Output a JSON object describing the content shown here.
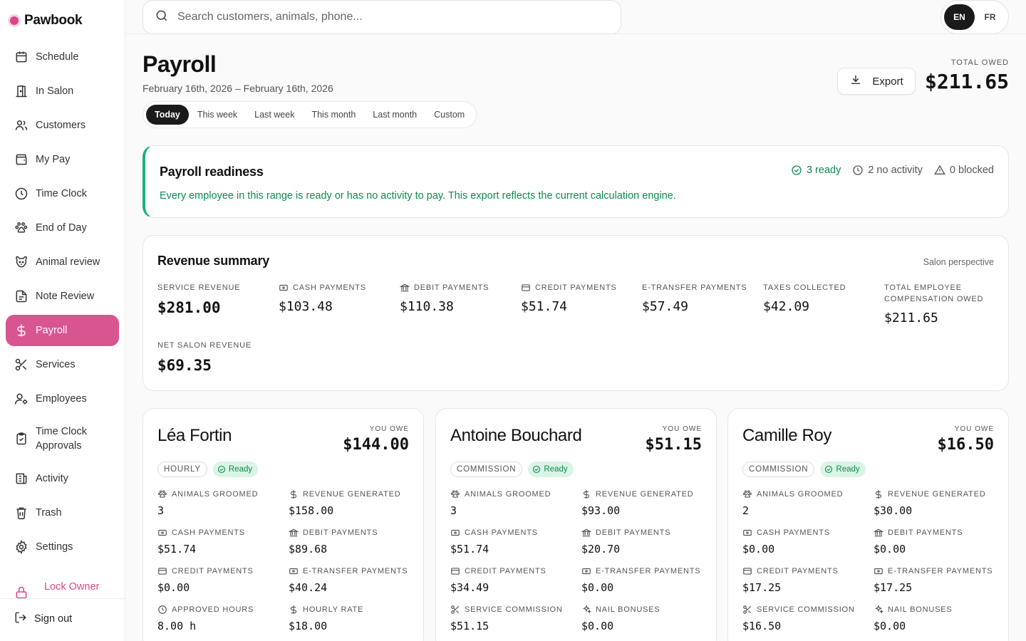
{
  "brand": {
    "name": "Pawbook",
    "accent": "#d9468c"
  },
  "sidebar": {
    "items": [
      {
        "label": "Schedule",
        "icon": "calendar-icon"
      },
      {
        "label": "In Salon",
        "icon": "door-icon"
      },
      {
        "label": "Customers",
        "icon": "users-icon"
      },
      {
        "label": "My Pay",
        "icon": "wallet-icon"
      },
      {
        "label": "Time Clock",
        "icon": "clock-icon"
      },
      {
        "label": "End of Day",
        "icon": "paw-icon"
      },
      {
        "label": "Animal review",
        "icon": "dog-icon"
      },
      {
        "label": "Note Review",
        "icon": "note-icon"
      },
      {
        "label": "Payroll",
        "icon": "dollar-icon",
        "active": true
      },
      {
        "label": "Services",
        "icon": "scissors-icon"
      },
      {
        "label": "Employees",
        "icon": "user-cog-icon"
      },
      {
        "label": "Time Clock Approvals",
        "icon": "clipboard-check-icon"
      },
      {
        "label": "Activity",
        "icon": "activity-icon"
      },
      {
        "label": "Trash",
        "icon": "trash-icon"
      },
      {
        "label": "Settings",
        "icon": "gear-icon"
      }
    ],
    "lock_label": "Lock Owner",
    "signout_label": "Sign out"
  },
  "topbar": {
    "search_placeholder": "Search customers, animals, phone...",
    "lang_en": "EN",
    "lang_fr": "FR"
  },
  "header": {
    "title": "Payroll",
    "date_range": "February 16th, 2026 – February 16th, 2026",
    "tabs": [
      "Today",
      "This week",
      "Last week",
      "This month",
      "Last month",
      "Custom"
    ],
    "active_tab": "Today",
    "export_label": "Export",
    "total_owed_label": "TOTAL OWED",
    "total_owed_value": "$211.65"
  },
  "readiness": {
    "title": "Payroll readiness",
    "message": "Every employee in this range is ready or has no activity to pay. This export reflects the current calculation engine.",
    "ready": "3 ready",
    "no_activity": "2 no activity",
    "blocked": "0 blocked",
    "status_color": "#19b37a"
  },
  "revenue": {
    "title": "Revenue summary",
    "perspective": "Salon perspective",
    "service_revenue": {
      "label": "SERVICE REVENUE",
      "value": "$281.00"
    },
    "cash": {
      "label": "CASH PAYMENTS",
      "value": "$103.48"
    },
    "debit": {
      "label": "DEBIT PAYMENTS",
      "value": "$110.38"
    },
    "credit": {
      "label": "CREDIT PAYMENTS",
      "value": "$51.74"
    },
    "etransfer": {
      "label": "E-TRANSFER PAYMENTS",
      "value": "$57.49"
    },
    "taxes": {
      "label": "TAXES COLLECTED",
      "value": "$42.09"
    },
    "total_comp": {
      "label": "TOTAL EMPLOYEE COMPENSATION OWED",
      "value": "$211.65"
    },
    "net": {
      "label": "NET SALON REVENUE",
      "value": "$69.35"
    }
  },
  "employees": [
    {
      "name": "Léa Fortin",
      "owe_label": "YOU OWE",
      "owe": "$144.00",
      "type": "HOURLY",
      "status": "Ready",
      "metrics": [
        {
          "label": "ANIMALS GROOMED",
          "value": "3"
        },
        {
          "label": "REVENUE GENERATED",
          "value": "$158.00"
        },
        {
          "label": "CASH PAYMENTS",
          "value": "$51.74"
        },
        {
          "label": "DEBIT PAYMENTS",
          "value": "$89.68"
        },
        {
          "label": "CREDIT PAYMENTS",
          "value": "$0.00"
        },
        {
          "label": "E-TRANSFER PAYMENTS",
          "value": "$40.24"
        },
        {
          "label": "APPROVED HOURS",
          "value": "8.00 h"
        },
        {
          "label": "HOURLY RATE",
          "value": "$18.00"
        }
      ]
    },
    {
      "name": "Antoine Bouchard",
      "owe_label": "YOU OWE",
      "owe": "$51.15",
      "type": "COMMISSION",
      "status": "Ready",
      "metrics": [
        {
          "label": "ANIMALS GROOMED",
          "value": "3"
        },
        {
          "label": "REVENUE GENERATED",
          "value": "$93.00"
        },
        {
          "label": "CASH PAYMENTS",
          "value": "$51.74"
        },
        {
          "label": "DEBIT PAYMENTS",
          "value": "$20.70"
        },
        {
          "label": "CREDIT PAYMENTS",
          "value": "$34.49"
        },
        {
          "label": "E-TRANSFER PAYMENTS",
          "value": "$0.00"
        },
        {
          "label": "SERVICE COMMISSION",
          "value": "$51.15"
        },
        {
          "label": "NAIL BONUSES",
          "value": "$0.00"
        }
      ]
    },
    {
      "name": "Camille Roy",
      "owe_label": "YOU OWE",
      "owe": "$16.50",
      "type": "COMMISSION",
      "status": "Ready",
      "metrics": [
        {
          "label": "ANIMALS GROOMED",
          "value": "2"
        },
        {
          "label": "REVENUE GENERATED",
          "value": "$30.00"
        },
        {
          "label": "CASH PAYMENTS",
          "value": "$0.00"
        },
        {
          "label": "DEBIT PAYMENTS",
          "value": "$0.00"
        },
        {
          "label": "CREDIT PAYMENTS",
          "value": "$17.25"
        },
        {
          "label": "E-TRANSFER PAYMENTS",
          "value": "$17.25"
        },
        {
          "label": "SERVICE COMMISSION",
          "value": "$16.50"
        },
        {
          "label": "NAIL BONUSES",
          "value": "$0.00"
        }
      ]
    }
  ]
}
